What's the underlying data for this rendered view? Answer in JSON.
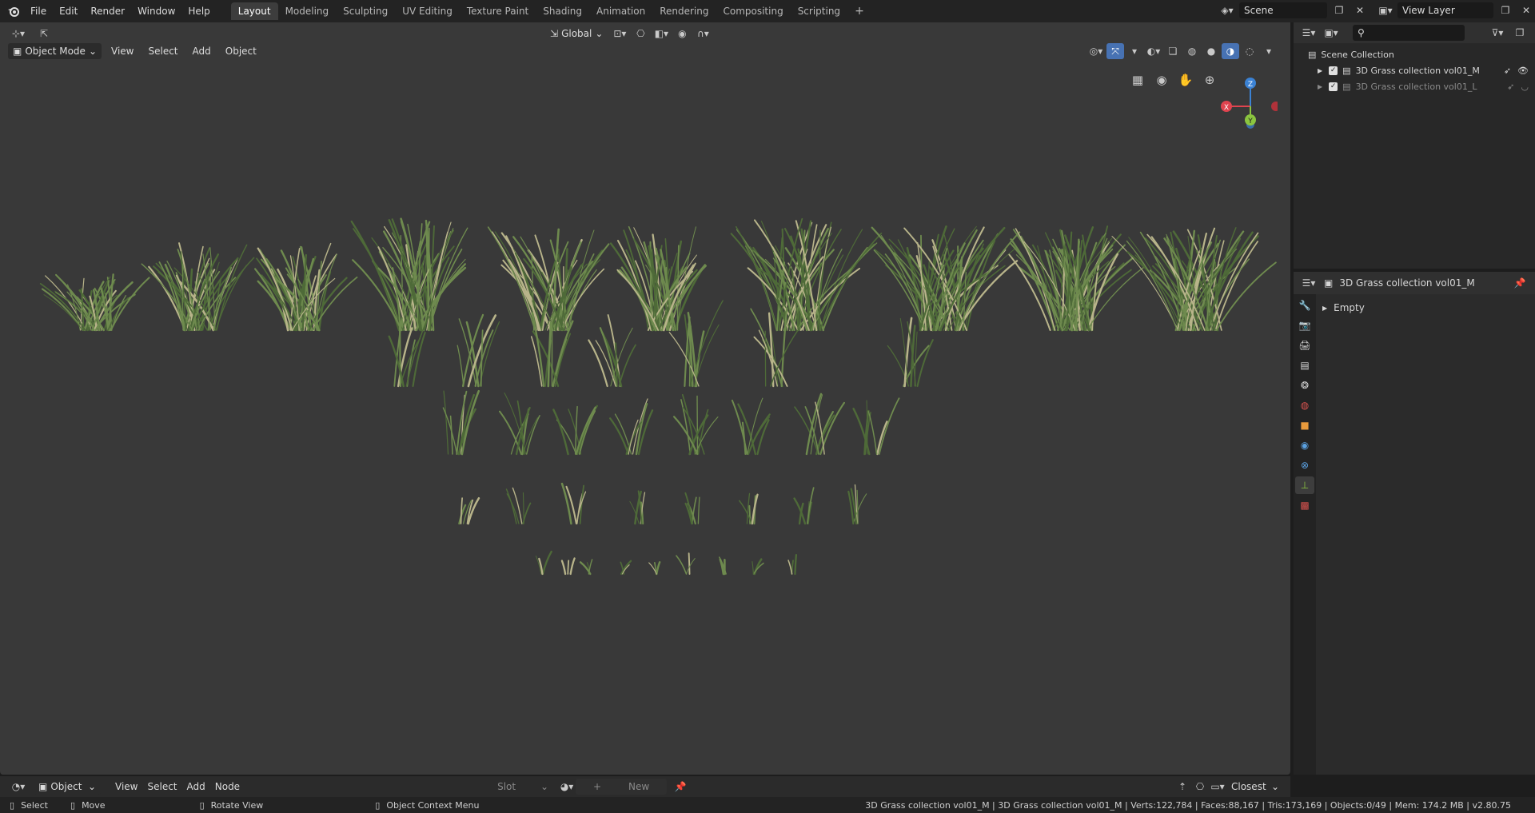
{
  "topbar": {
    "menus": [
      "File",
      "Edit",
      "Render",
      "Window",
      "Help"
    ],
    "workspaces": [
      "Layout",
      "Modeling",
      "Sculpting",
      "UV Editing",
      "Texture Paint",
      "Shading",
      "Animation",
      "Rendering",
      "Compositing",
      "Scripting"
    ],
    "active_workspace": "Layout",
    "add_tab": "+",
    "scene": "Scene",
    "view_layer": "View Layer"
  },
  "viewport": {
    "mode": "Object Mode",
    "menus": [
      "View",
      "Select",
      "Add",
      "Object"
    ],
    "transform_orientation": "Global",
    "gizmo": {
      "x": "X",
      "y": "Y",
      "z": "Z"
    }
  },
  "outliner": {
    "root": "Scene Collection",
    "items": [
      {
        "label": "3D Grass collection vol01_M"
      },
      {
        "label": "3D Grass collection vol01_L"
      }
    ]
  },
  "properties": {
    "title": "3D Grass collection vol01_M",
    "section": "Empty"
  },
  "node_header": {
    "type": "Object",
    "menus": [
      "View",
      "Select",
      "Add",
      "Node"
    ],
    "slot": "Slot",
    "new_label": "New",
    "snap": "Closest"
  },
  "statusbar": {
    "select": "Select",
    "move": "Move",
    "rotate": "Rotate View",
    "context": "Object Context Menu",
    "stats": "3D Grass collection vol01_M | 3D Grass collection vol01_M | Verts:122,784 | Faces:88,167 | Tris:173,169 | Objects:0/49 | Mem: 174.2 MB | v2.80.75"
  },
  "colors": {
    "viewport_bg": "#393939",
    "accent": "#4772b3",
    "x_axis": "#e0444f",
    "y_axis": "#8bc53f",
    "z_axis": "#3b82d4"
  }
}
